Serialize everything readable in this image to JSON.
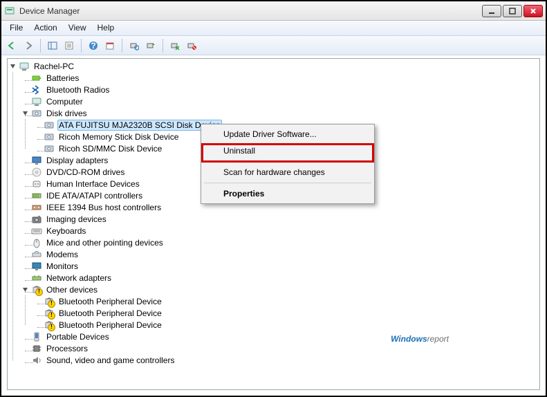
{
  "window": {
    "title": "Device Manager"
  },
  "menu": {
    "file": "File",
    "action": "Action",
    "view": "View",
    "help": "Help"
  },
  "tree": {
    "root": "Rachel-PC",
    "categories": [
      {
        "name": "Batteries",
        "icon": "battery"
      },
      {
        "name": "Bluetooth Radios",
        "icon": "bluetooth"
      },
      {
        "name": "Computer",
        "icon": "computer"
      },
      {
        "name": "Disk drives",
        "icon": "disk",
        "expanded": true,
        "children": [
          {
            "name": "ATA FUJITSU MJA2320B SCSI Disk Device",
            "icon": "disk",
            "selected": true
          },
          {
            "name": "Ricoh Memory Stick Disk Device",
            "icon": "disk"
          },
          {
            "name": "Ricoh SD/MMC Disk Device",
            "icon": "disk"
          }
        ]
      },
      {
        "name": "Display adapters",
        "icon": "display"
      },
      {
        "name": "DVD/CD-ROM drives",
        "icon": "dvd"
      },
      {
        "name": "Human Interface Devices",
        "icon": "hid"
      },
      {
        "name": "IDE ATA/ATAPI controllers",
        "icon": "ide"
      },
      {
        "name": "IEEE 1394 Bus host controllers",
        "icon": "ieee"
      },
      {
        "name": "Imaging devices",
        "icon": "imaging"
      },
      {
        "name": "Keyboards",
        "icon": "keyboard"
      },
      {
        "name": "Mice and other pointing devices",
        "icon": "mouse"
      },
      {
        "name": "Modems",
        "icon": "modem"
      },
      {
        "name": "Monitors",
        "icon": "monitor"
      },
      {
        "name": "Network adapters",
        "icon": "network"
      },
      {
        "name": "Other devices",
        "icon": "other",
        "warn": true,
        "expanded": true,
        "children": [
          {
            "name": "Bluetooth Peripheral Device",
            "icon": "other",
            "warn": true
          },
          {
            "name": "Bluetooth Peripheral Device",
            "icon": "other",
            "warn": true
          },
          {
            "name": "Bluetooth Peripheral Device",
            "icon": "other",
            "warn": true
          }
        ]
      },
      {
        "name": "Portable Devices",
        "icon": "portable"
      },
      {
        "name": "Processors",
        "icon": "cpu"
      },
      {
        "name": "Sound, video and game controllers",
        "icon": "sound"
      }
    ]
  },
  "context_menu": {
    "items": [
      {
        "label": "Update Driver Software..."
      },
      {
        "label": "Uninstall",
        "highlighted": true
      },
      {
        "sep": true
      },
      {
        "label": "Scan for hardware changes"
      },
      {
        "sep": true
      },
      {
        "label": "Properties",
        "bold": true
      }
    ]
  },
  "watermark": {
    "part1": "Windows",
    "part2": "report"
  }
}
